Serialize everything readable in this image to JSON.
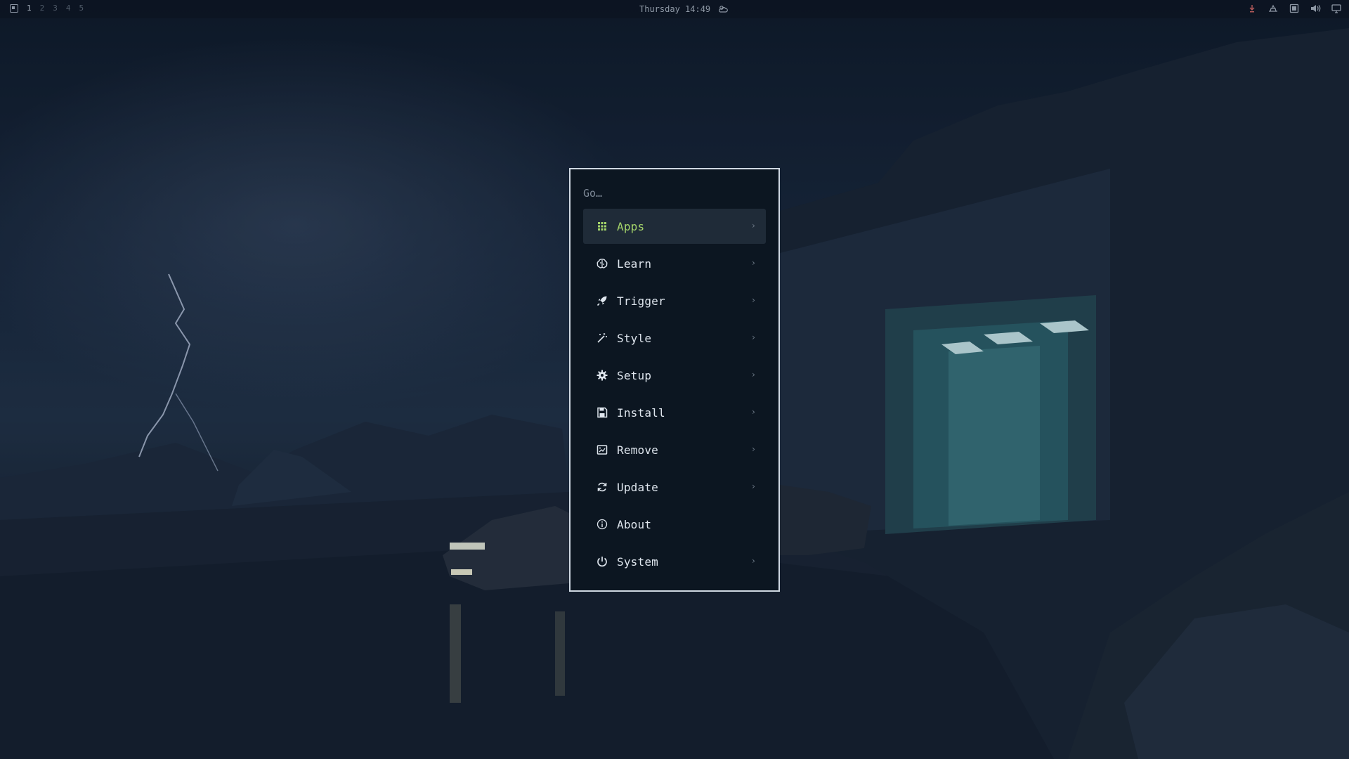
{
  "topbar": {
    "workspaces": [
      "1",
      "2",
      "3",
      "4",
      "5"
    ],
    "active_workspace": "1",
    "clock": "Thursday 14:49",
    "weather_icon": "cloud-sun-icon",
    "tray_icons": [
      "download-icon",
      "network-icon",
      "screen-icon",
      "volume-icon",
      "display-icon"
    ]
  },
  "menu": {
    "search_placeholder": "Go…",
    "selected_index": 0,
    "accent_color": "#a4d46a",
    "items": [
      {
        "label": "Apps",
        "icon": "grid-icon",
        "has_submenu": true
      },
      {
        "label": "Learn",
        "icon": "brain-icon",
        "has_submenu": true
      },
      {
        "label": "Trigger",
        "icon": "rocket-icon",
        "has_submenu": true
      },
      {
        "label": "Style",
        "icon": "magic-wand-icon",
        "has_submenu": true
      },
      {
        "label": "Setup",
        "icon": "gear-icon",
        "has_submenu": true
      },
      {
        "label": "Install",
        "icon": "floppy-disk-icon",
        "has_submenu": true
      },
      {
        "label": "Remove",
        "icon": "box-remove-icon",
        "has_submenu": true
      },
      {
        "label": "Update",
        "icon": "refresh-icon",
        "has_submenu": true
      },
      {
        "label": "About",
        "icon": "info-icon",
        "has_submenu": false
      },
      {
        "label": "System",
        "icon": "power-icon",
        "has_submenu": true
      }
    ],
    "submenu_arrow": "›"
  }
}
